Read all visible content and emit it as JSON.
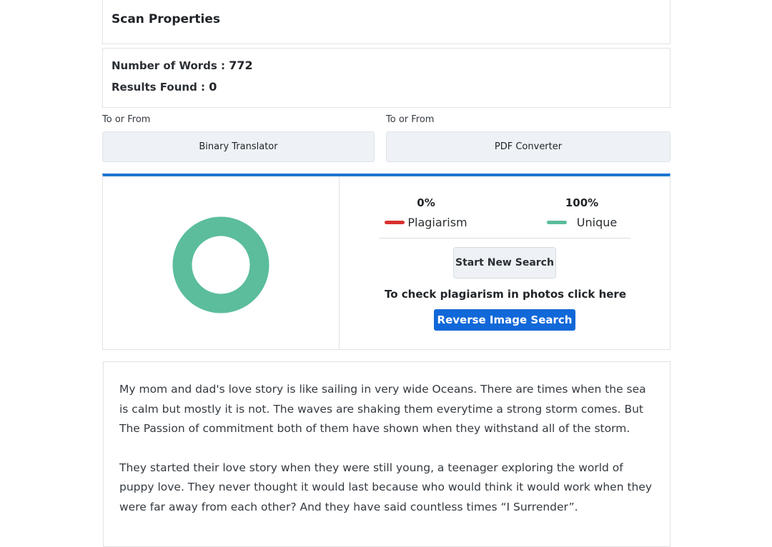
{
  "scan": {
    "title": "Scan Properties",
    "words_label": "Number of Words :",
    "words_value": "772",
    "results_label": "Results Found :",
    "results_value": "0"
  },
  "tools": [
    {
      "label": "To or From",
      "button": "Binary Translator"
    },
    {
      "label": "To or From",
      "button": "PDF Converter"
    }
  ],
  "result": {
    "plagiarism_pct": "0%",
    "plagiarism_label": "Plagiarism",
    "unique_pct": "100%",
    "unique_label": "Unique",
    "new_search": "Start New Search",
    "photo_text": "To check plagiarism in photos click here",
    "reverse_btn": "Reverse Image Search",
    "colors": {
      "plagiarism": "#d9312f",
      "unique": "#5bbd9b",
      "accent": "#1c76d0"
    },
    "donut": {
      "plagiarism_fraction": 0,
      "unique_fraction": 1
    }
  },
  "content": {
    "paragraphs": [
      "My mom and dad's love story is like sailing in very wide Oceans. There are times when the sea is calm but mostly it is not. The waves are shaking them everytime a strong storm comes. But The Passion of commitment both of them have shown when they withstand all of the storm.",
      "They started their love story when they were still young, a teenager exploring the world of puppy love. They never thought it would last because who would think it would work when they were far away from each other? And they have said countless times “I Surrender”."
    ]
  }
}
